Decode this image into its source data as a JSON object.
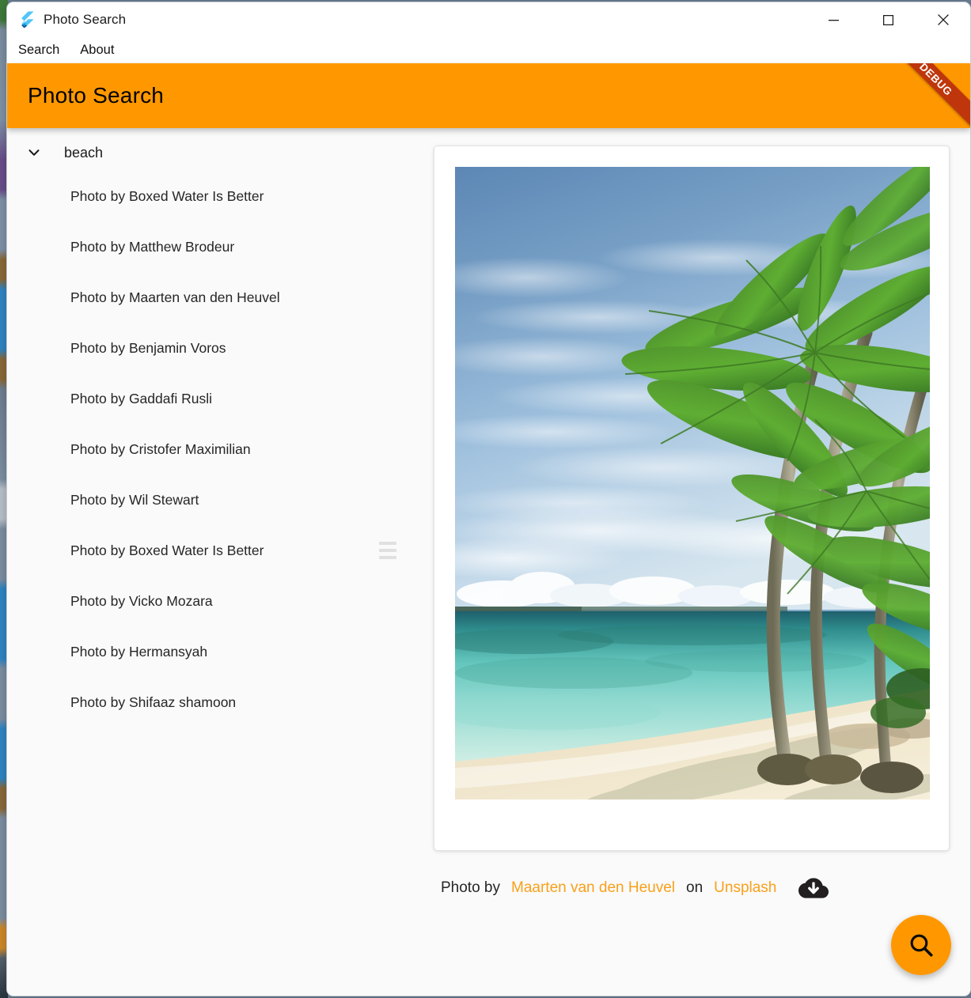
{
  "window": {
    "title": "Photo Search",
    "app_icon": "flutter-logo-icon",
    "controls": {
      "minimize": "minimize-icon",
      "maximize": "maximize-icon",
      "close": "close-icon"
    }
  },
  "menubar": {
    "items": [
      {
        "label": "Search"
      },
      {
        "label": "About"
      }
    ]
  },
  "appbar": {
    "title": "Photo Search",
    "background_color": "#FF9800",
    "debug_banner": "DEBUG",
    "debug_banner_color": "#BF360C"
  },
  "results": {
    "group": {
      "label": "beach",
      "expanded": true,
      "chevron_icon": "chevron-down-icon"
    },
    "items": [
      {
        "label": "Photo by Boxed Water Is Better",
        "has_handle": false
      },
      {
        "label": "Photo by Matthew Brodeur",
        "has_handle": false
      },
      {
        "label": "Photo by Maarten van den Heuvel",
        "has_handle": false
      },
      {
        "label": "Photo by Benjamin Voros",
        "has_handle": false
      },
      {
        "label": "Photo by Gaddafi Rusli",
        "has_handle": false
      },
      {
        "label": "Photo by Cristofer Maximilian",
        "has_handle": false
      },
      {
        "label": "Photo by Wil Stewart",
        "has_handle": false
      },
      {
        "label": "Photo by Boxed Water Is Better",
        "has_handle": true
      },
      {
        "label": "Photo by Vicko Mozara",
        "has_handle": false
      },
      {
        "label": "Photo by Hermansyah",
        "has_handle": false
      },
      {
        "label": "Photo by Shifaaz shamoon",
        "has_handle": false
      }
    ]
  },
  "detail": {
    "photo_alt": "tropical beach with palm trees over turquoise water",
    "attribution": {
      "prefix": "Photo by",
      "author": "Maarten van den Heuvel",
      "middle": "on",
      "source": "Unsplash",
      "link_color": "#F9A01B",
      "download_icon": "cloud-download-icon"
    }
  },
  "fab": {
    "icon": "search-icon",
    "color": "#FF9800"
  }
}
